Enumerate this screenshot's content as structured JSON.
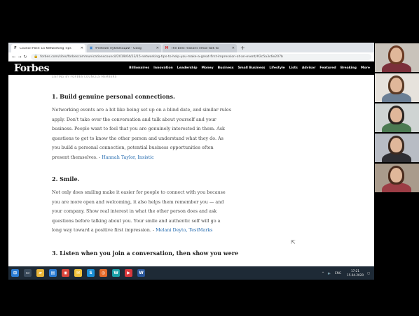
{
  "browser": {
    "tabs": [
      {
        "icon": "F",
        "title": "Council Post: 15 Networking Tips",
        "active": true
      },
      {
        "icon": "▣",
        "title": "Учебник публикации - Goog",
        "active": false
      },
      {
        "icon": "M",
        "title": "The best reasons email talk to",
        "active": false
      }
    ],
    "new_tab": "+",
    "url": "forbes.com/sites/forbescommunicationscouncil/2019/04/23/15-networking-tips-to-help-you-make-a-great-first-impression-at-an-event/#2c5a3c6e207b"
  },
  "forbes": {
    "logo": "Forbes",
    "nav": [
      "Billionaires",
      "Innovation",
      "Leadership",
      "Money",
      "Business",
      "Small Business",
      "Lifestyle",
      "Lists",
      "Advisor",
      "Featured",
      "Breaking",
      "More"
    ]
  },
  "article": {
    "caption": "LISTING BY FORBES COUNCILS MEMBERS",
    "sections": [
      {
        "heading": "1. Build genuine personal connections.",
        "lines": [
          "Networking events are a bit like being set up on a blind date, and similar rules",
          "apply. Don't take over the conversation and talk about yourself and your",
          "business. People want to feel that you are genuinely interested in them. Ask",
          "questions to get to know the other person and understand what they do. As",
          "you build a personal connection, potential business opportunities often"
        ],
        "last_line": "present themselves. - ",
        "author": "Hannah Taylor, Insistic"
      },
      {
        "heading": "2. Smile.",
        "lines": [
          "Not only does smiling make it easier for people to connect with you because",
          "you are more open and welcoming, it also helps them remember you — and",
          "your company. Show real interest in what the other person does and ask",
          "questions before talking about you. Your smile and authentic self will go a"
        ],
        "last_line": "long way toward a positive first impression. - ",
        "author": "Melani Deyto, TestMarks"
      },
      {
        "heading": "3. Listen when you join a conversation, then show you were"
      }
    ]
  },
  "taskbar": {
    "icons": [
      {
        "name": "windows-start-icon",
        "glyph": "⊞",
        "color": "#2b7cd3"
      },
      {
        "name": "task-view-icon",
        "glyph": "▭",
        "color": "#3a4b5c"
      },
      {
        "name": "file-explorer-icon",
        "glyph": "▰",
        "color": "#e8b53a"
      },
      {
        "name": "store-icon",
        "glyph": "▤",
        "color": "#2b7cd3"
      },
      {
        "name": "chrome-icon",
        "glyph": "◉",
        "color": "#d9463c"
      },
      {
        "name": "mail-icon",
        "glyph": "✉",
        "color": "#f0c23c"
      },
      {
        "name": "skype-icon",
        "glyph": "S",
        "color": "#1a8fd6"
      },
      {
        "name": "firefox-icon",
        "glyph": "◎",
        "color": "#e56b2b"
      },
      {
        "name": "app-tile-icon",
        "glyph": "W",
        "color": "#1aa1a8"
      },
      {
        "name": "media-icon",
        "glyph": "▶",
        "color": "#d9383c"
      },
      {
        "name": "word-icon",
        "glyph": "W",
        "color": "#2a5699"
      }
    ],
    "tray": {
      "arrow": "^",
      "lang": "ENG",
      "time": "17:21",
      "date": "15.04.2020"
    }
  },
  "participants": [
    {
      "hair": "#6b3a23",
      "shirt": "#7b2f3a",
      "bg": "#c9c3bb"
    },
    {
      "hair": "#5a3a26",
      "shirt": "#6b7f95",
      "bg": "#e6e2dc"
    },
    {
      "hair": "#2b2420",
      "shirt": "#4c7a52",
      "bg": "#cfd4d3"
    },
    {
      "hair": "#3d2a20",
      "shirt": "#2e2e33",
      "bg": "#b8bcc4"
    },
    {
      "hair": "#4a2b1d",
      "shirt": "#9c3d45",
      "bg": "#a99b8c"
    }
  ]
}
